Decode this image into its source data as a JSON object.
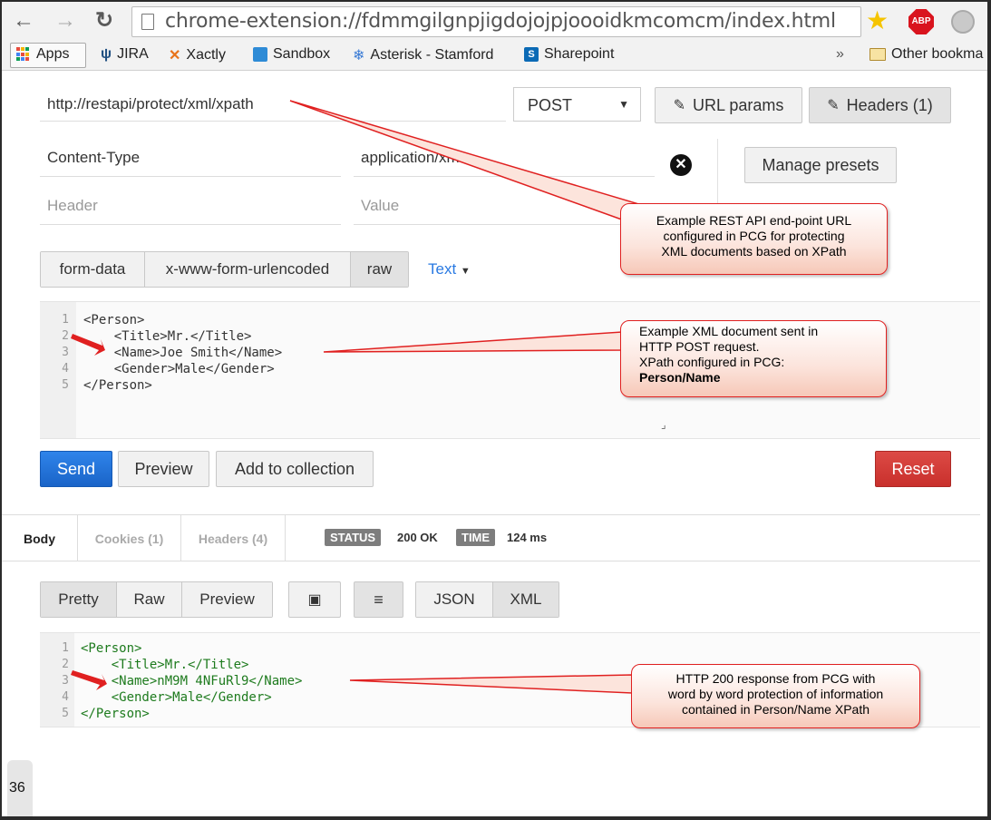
{
  "browser": {
    "url": "chrome-extension://fdmmgilgnpjigdojojpjoooidkmcomcm/index.html",
    "extensions": [
      "ABP"
    ]
  },
  "bookmarks": {
    "items": [
      "Apps",
      "JIRA",
      "Xactly",
      "Sandbox",
      "Asterisk - Stamford",
      "Sharepoint"
    ],
    "overflow": "»",
    "other": "Other bookma"
  },
  "request": {
    "url": "http://restapi/protect/xml/xpath",
    "method": "POST",
    "url_params_label": "URL params",
    "headers_label": "Headers (1)",
    "header_rows": [
      {
        "key": "Content-Type",
        "value": "application/xml"
      }
    ],
    "header_placeholder": "Header",
    "value_placeholder": "Value",
    "manage_presets_label": "Manage presets",
    "body_tabs": [
      "form-data",
      "x-www-form-urlencoded",
      "raw"
    ],
    "body_type": "Text",
    "body_lines": [
      "<Person>",
      "    <Title>Mr.</Title>",
      "    <Name>Joe Smith</Name>",
      "    <Gender>Male</Gender>",
      "</Person>"
    ],
    "line_numbers": [
      "1",
      "2",
      "3",
      "4",
      "5"
    ],
    "send_label": "Send",
    "preview_label": "Preview",
    "add_to_collection_label": "Add to collection",
    "reset_label": "Reset"
  },
  "response": {
    "tabs": [
      "Body",
      "Cookies (1)",
      "Headers (4)"
    ],
    "status_label": "STATUS",
    "status_value": "200 OK",
    "time_label": "TIME",
    "time_value": "124 ms",
    "view_tabs": [
      "Pretty",
      "Raw",
      "Preview"
    ],
    "format_tabs": [
      "JSON",
      "XML"
    ],
    "body_lines": [
      "<Person>",
      "    <Title>Mr.</Title>",
      "    <Name>nM9M 4NFuRl9</Name>",
      "    <Gender>Male</Gender>",
      "</Person>"
    ],
    "line_numbers": [
      "1",
      "2",
      "3",
      "4",
      "5"
    ]
  },
  "callouts": {
    "url_note": [
      "Example REST API end-point URL",
      "configured in PCG for protecting",
      "XML documents based on XPath"
    ],
    "xml_note": [
      "Example XML document sent in",
      "HTTP POST request.",
      "XPath configured in PCG:"
    ],
    "xml_note_bold": "Person/Name",
    "response_note": [
      "HTTP 200 response from PCG with",
      "word by word protection of information",
      "contained in Person/Name XPath"
    ]
  },
  "slide": {
    "page_number": "36"
  },
  "colors": {
    "send": "#2a7ae2",
    "reset": "#c9302c",
    "callout_border": "#e02020",
    "arrow": "#e02020",
    "response_code": "#1e7b1e"
  }
}
